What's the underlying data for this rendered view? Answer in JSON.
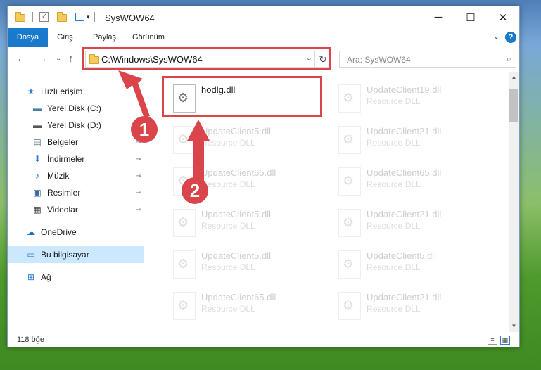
{
  "window": {
    "title": "SysWOW64",
    "minimize": "─",
    "maximize": "☐",
    "close": "✕"
  },
  "ribbon": {
    "tabs": [
      "Dosya",
      "Giriş",
      "Paylaş",
      "Görünüm"
    ],
    "help": "?",
    "chevron": "⌄"
  },
  "nav": {
    "back": "←",
    "forward": "→",
    "recent": "⌄",
    "up": "↑",
    "address": "C:\\Windows\\SysWOW64",
    "address_drop": "⌄",
    "refresh": "↻",
    "search_placeholder": "Ara: SysWOW64",
    "search_icon": "⌕"
  },
  "sidebar": {
    "items": [
      {
        "label": "Hızlı erişim",
        "icon": "star-icon",
        "glyph": "★",
        "color": "#2b7cd3",
        "pinned": false
      },
      {
        "label": "Yerel Disk (C:)",
        "icon": "drive-icon",
        "glyph": "▬",
        "color": "#4a7fa8",
        "pinned": false
      },
      {
        "label": "Yerel Disk (D:)",
        "icon": "drive-icon",
        "glyph": "▬",
        "color": "#555",
        "pinned": false
      },
      {
        "label": "Belgeler",
        "icon": "documents-icon",
        "glyph": "▤",
        "color": "#5a6f86",
        "pinned": true
      },
      {
        "label": "İndirmeler",
        "icon": "download-icon",
        "glyph": "⬇",
        "color": "#2b7cd3",
        "pinned": true
      },
      {
        "label": "Müzik",
        "icon": "music-icon",
        "glyph": "♪",
        "color": "#2b7cd3",
        "pinned": true
      },
      {
        "label": "Resimler",
        "icon": "pictures-icon",
        "glyph": "▣",
        "color": "#3b6a9a",
        "pinned": true
      },
      {
        "label": "Videolar",
        "icon": "videos-icon",
        "glyph": "▦",
        "color": "#333",
        "pinned": true
      },
      {
        "label": "OneDrive",
        "icon": "cloud-icon",
        "glyph": "☁",
        "color": "#1f6fc5",
        "pinned": false
      },
      {
        "label": "Bu bilgisayar",
        "icon": "computer-icon",
        "glyph": "▭",
        "color": "#2b7cd3",
        "pinned": false
      },
      {
        "label": "Ağ",
        "icon": "network-icon",
        "glyph": "⊞",
        "color": "#2b7cd3",
        "pinned": false
      }
    ],
    "pin_glyph": "📌"
  },
  "files": [
    {
      "name": "hodlg.dll",
      "type": "",
      "faded": false
    },
    {
      "name": "UpdateClient19.dll",
      "type": "Resource DLL",
      "faded": true
    },
    {
      "name": "UpdateClient5.dll",
      "type": "Resource DLL",
      "faded": true
    },
    {
      "name": "UpdateClient21.dll",
      "type": "Resource DLL",
      "faded": true
    },
    {
      "name": "UpdateClient65.dll",
      "type": "Resource DLL",
      "faded": true
    },
    {
      "name": "UpdateClient65.dll",
      "type": "Resource DLL",
      "faded": true
    },
    {
      "name": "UpdateClient5.dll",
      "type": "Resource DLL",
      "faded": true
    },
    {
      "name": "UpdateClient21.dll",
      "type": "Resource DLL",
      "faded": true
    },
    {
      "name": "UpdateClient5.dll",
      "type": "Resource DLL",
      "faded": true
    },
    {
      "name": "UpdateClient5.dll",
      "type": "Resource DLL",
      "faded": true
    },
    {
      "name": "UpdateClient65.dll",
      "type": "Resource DLL",
      "faded": true
    },
    {
      "name": "UpdateClient21.dll",
      "type": "Resource DLL",
      "faded": true
    }
  ],
  "status": {
    "count": "118 öğe"
  },
  "annotations": {
    "badge1": "1",
    "badge2": "2",
    "color": "#d9454a"
  }
}
